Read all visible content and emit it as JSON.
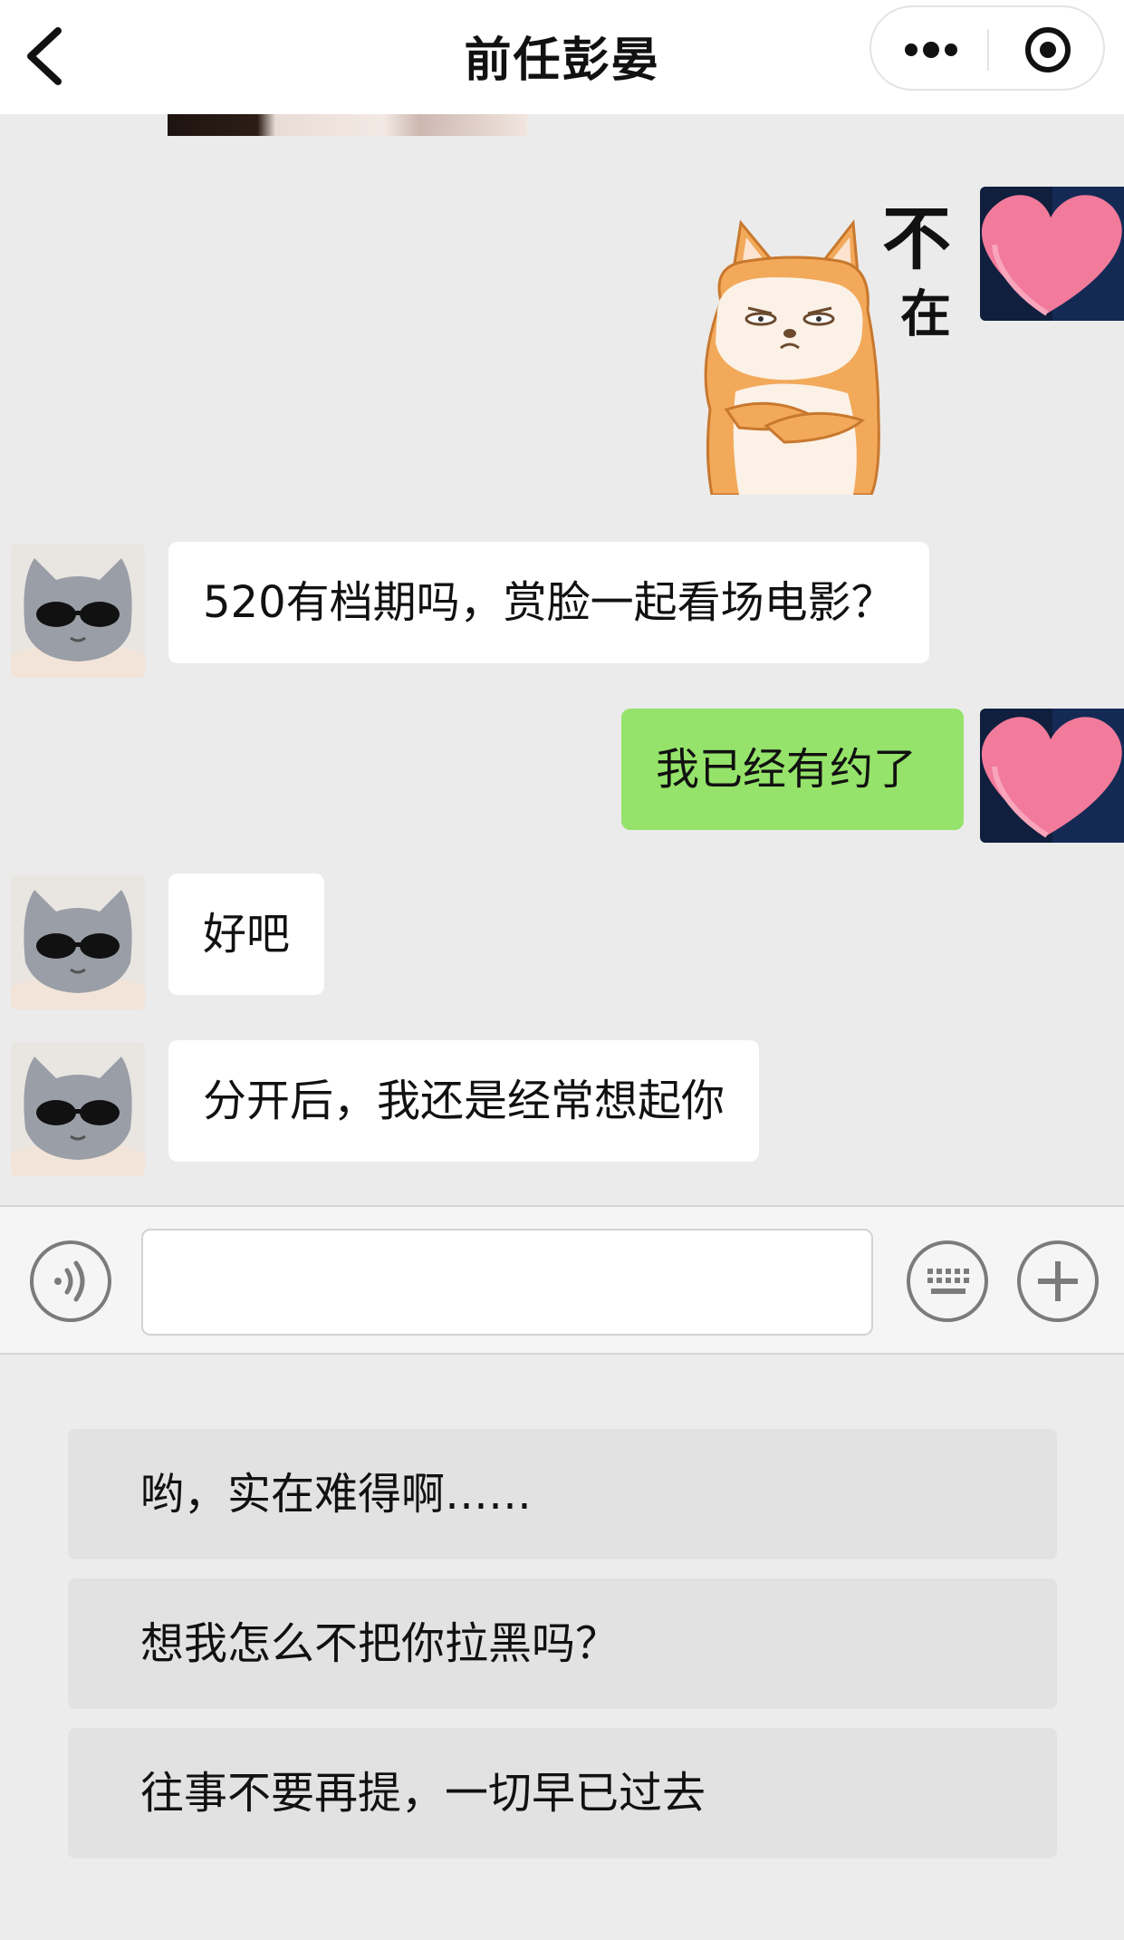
{
  "header": {
    "title": "前任彭晏",
    "back_icon": "chevron-left-icon",
    "more_icon": "more-dots-icon",
    "close_icon": "record-target-icon"
  },
  "messages": [
    {
      "side": "right",
      "type": "sticker",
      "sticker_text_line1": "不",
      "sticker_text_line2": "在",
      "sticker_icon": "grumpy-shiba-dog-sticker"
    },
    {
      "side": "left",
      "type": "text",
      "text": "520有档期吗，赏脸一起看场电影？"
    },
    {
      "side": "right",
      "type": "text",
      "text": "我已经有约了"
    },
    {
      "side": "left",
      "type": "text",
      "text": "好吧"
    },
    {
      "side": "left",
      "type": "text",
      "text": "分开后，我还是经常想起你"
    }
  ],
  "input_bar": {
    "voice_icon": "voice-icon",
    "keyboard_icon": "keyboard-icon",
    "plus_icon": "plus-icon",
    "input_value": ""
  },
  "reply_options": [
    "哟，实在难得啊……",
    "想我怎么不把你拉黑吗？",
    "往事不要再提，一切早已过去"
  ],
  "colors": {
    "header_bg": "#ffffff",
    "chat_bg": "#ebebeb",
    "my_bubble": "#95e36a",
    "their_bubble": "#ffffff",
    "heart": "#f27a9a"
  }
}
